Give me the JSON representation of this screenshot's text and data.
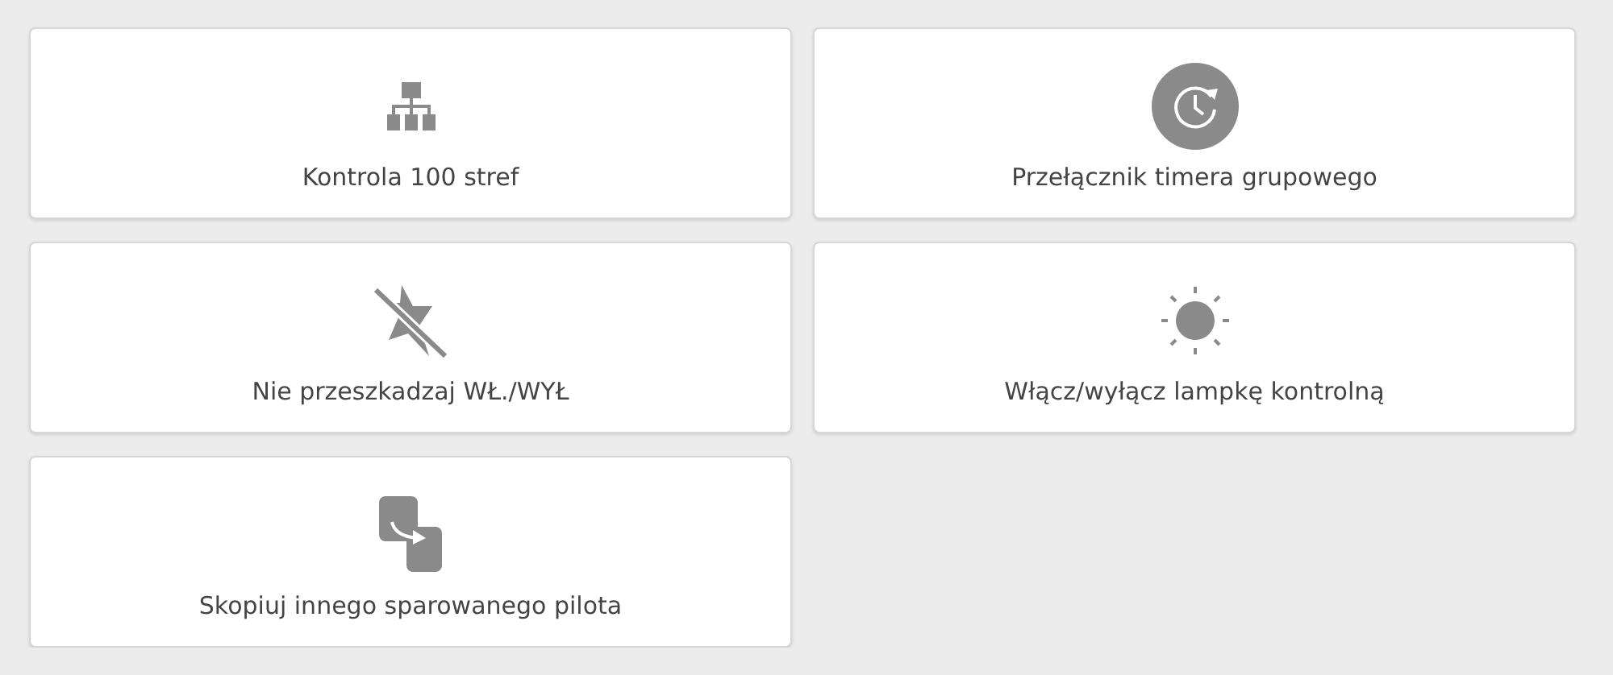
{
  "tiles": [
    {
      "kind": "zones",
      "label": "Kontrola 100 stref"
    },
    {
      "kind": "timer",
      "label": "Przełącznik timera grupowego"
    },
    {
      "kind": "dnd",
      "label": "Nie przeszkadzaj WŁ./WYŁ"
    },
    {
      "kind": "lamp",
      "label": "Włącz/wyłącz lampkę kontrolną"
    },
    {
      "kind": "copy",
      "label": "Skopiuj innego sparowanego pilota"
    }
  ]
}
